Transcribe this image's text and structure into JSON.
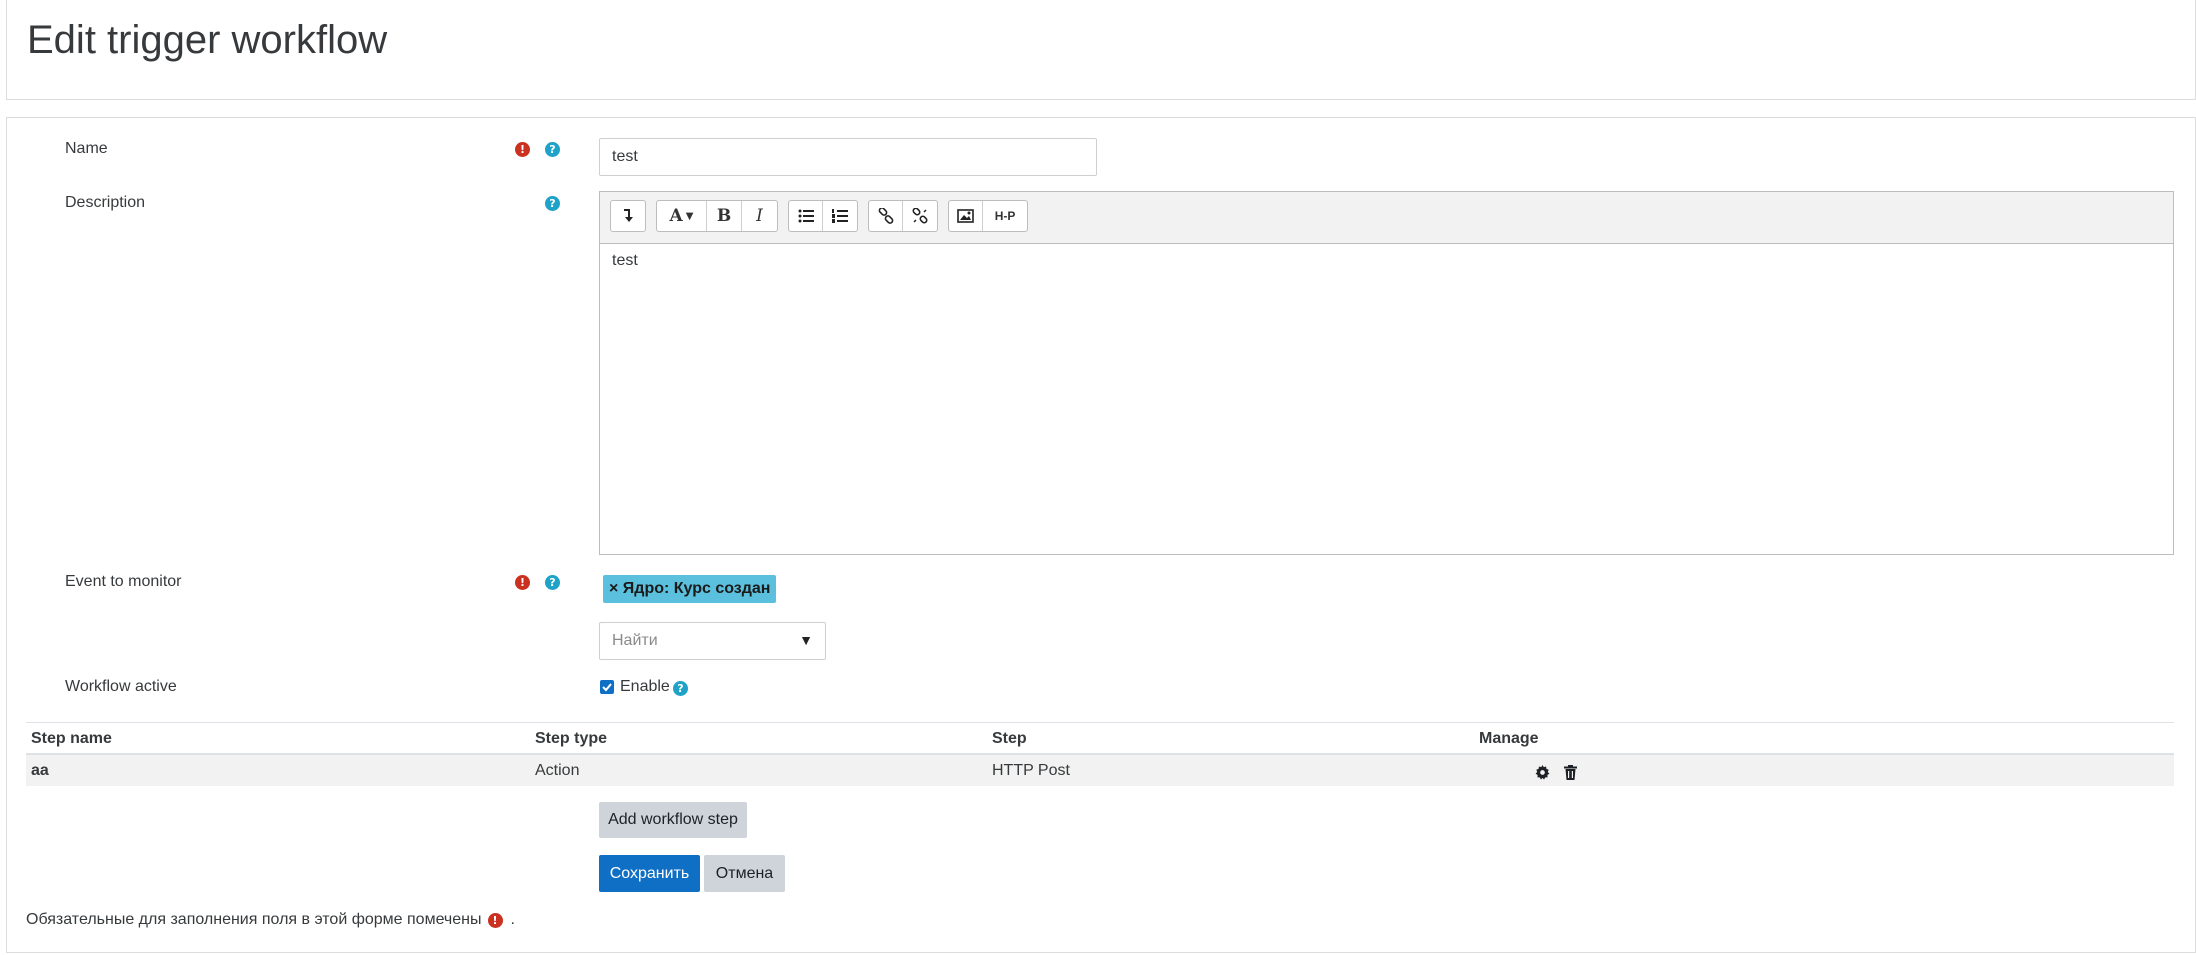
{
  "page": {
    "title": "Edit trigger workflow"
  },
  "form": {
    "name": {
      "label": "Name",
      "value": "test"
    },
    "description": {
      "label": "Description",
      "content": "test",
      "toolbar": {
        "buttons": [
          "collapse",
          "font",
          "bold",
          "italic",
          "bullet-list",
          "numbered-list",
          "link",
          "unlink",
          "image",
          "h5p"
        ],
        "font_glyph": "A",
        "bold_glyph": "B",
        "italic_glyph": "I",
        "h5p_glyph": "H-P"
      }
    },
    "event": {
      "label": "Event to monitor",
      "selected_tag": "× Ядро: Курс создан",
      "search_placeholder": "Найти",
      "dropdown_arrow": "▼"
    },
    "workflow_active": {
      "label": "Workflow active",
      "checkbox_label": "Enable",
      "checked": true
    }
  },
  "steps_table": {
    "headers": [
      "Step name",
      "Step type",
      "Step",
      "Manage"
    ],
    "rows": [
      {
        "step_name": "aa",
        "step_type": "Action",
        "step": "HTTP Post"
      }
    ]
  },
  "buttons": {
    "add_step": "Add workflow step",
    "save": "Сохранить",
    "cancel": "Отмена"
  },
  "footer": {
    "required_note": "Обязательные для заполнения поля в этой форме помечены",
    "trailing": "."
  },
  "icons": {
    "required": "!",
    "help": "?"
  },
  "colors": {
    "primary": "#0f6fc5",
    "required": "#ca3120",
    "help": "#1fa2c8",
    "tag": "#5bc0de"
  }
}
